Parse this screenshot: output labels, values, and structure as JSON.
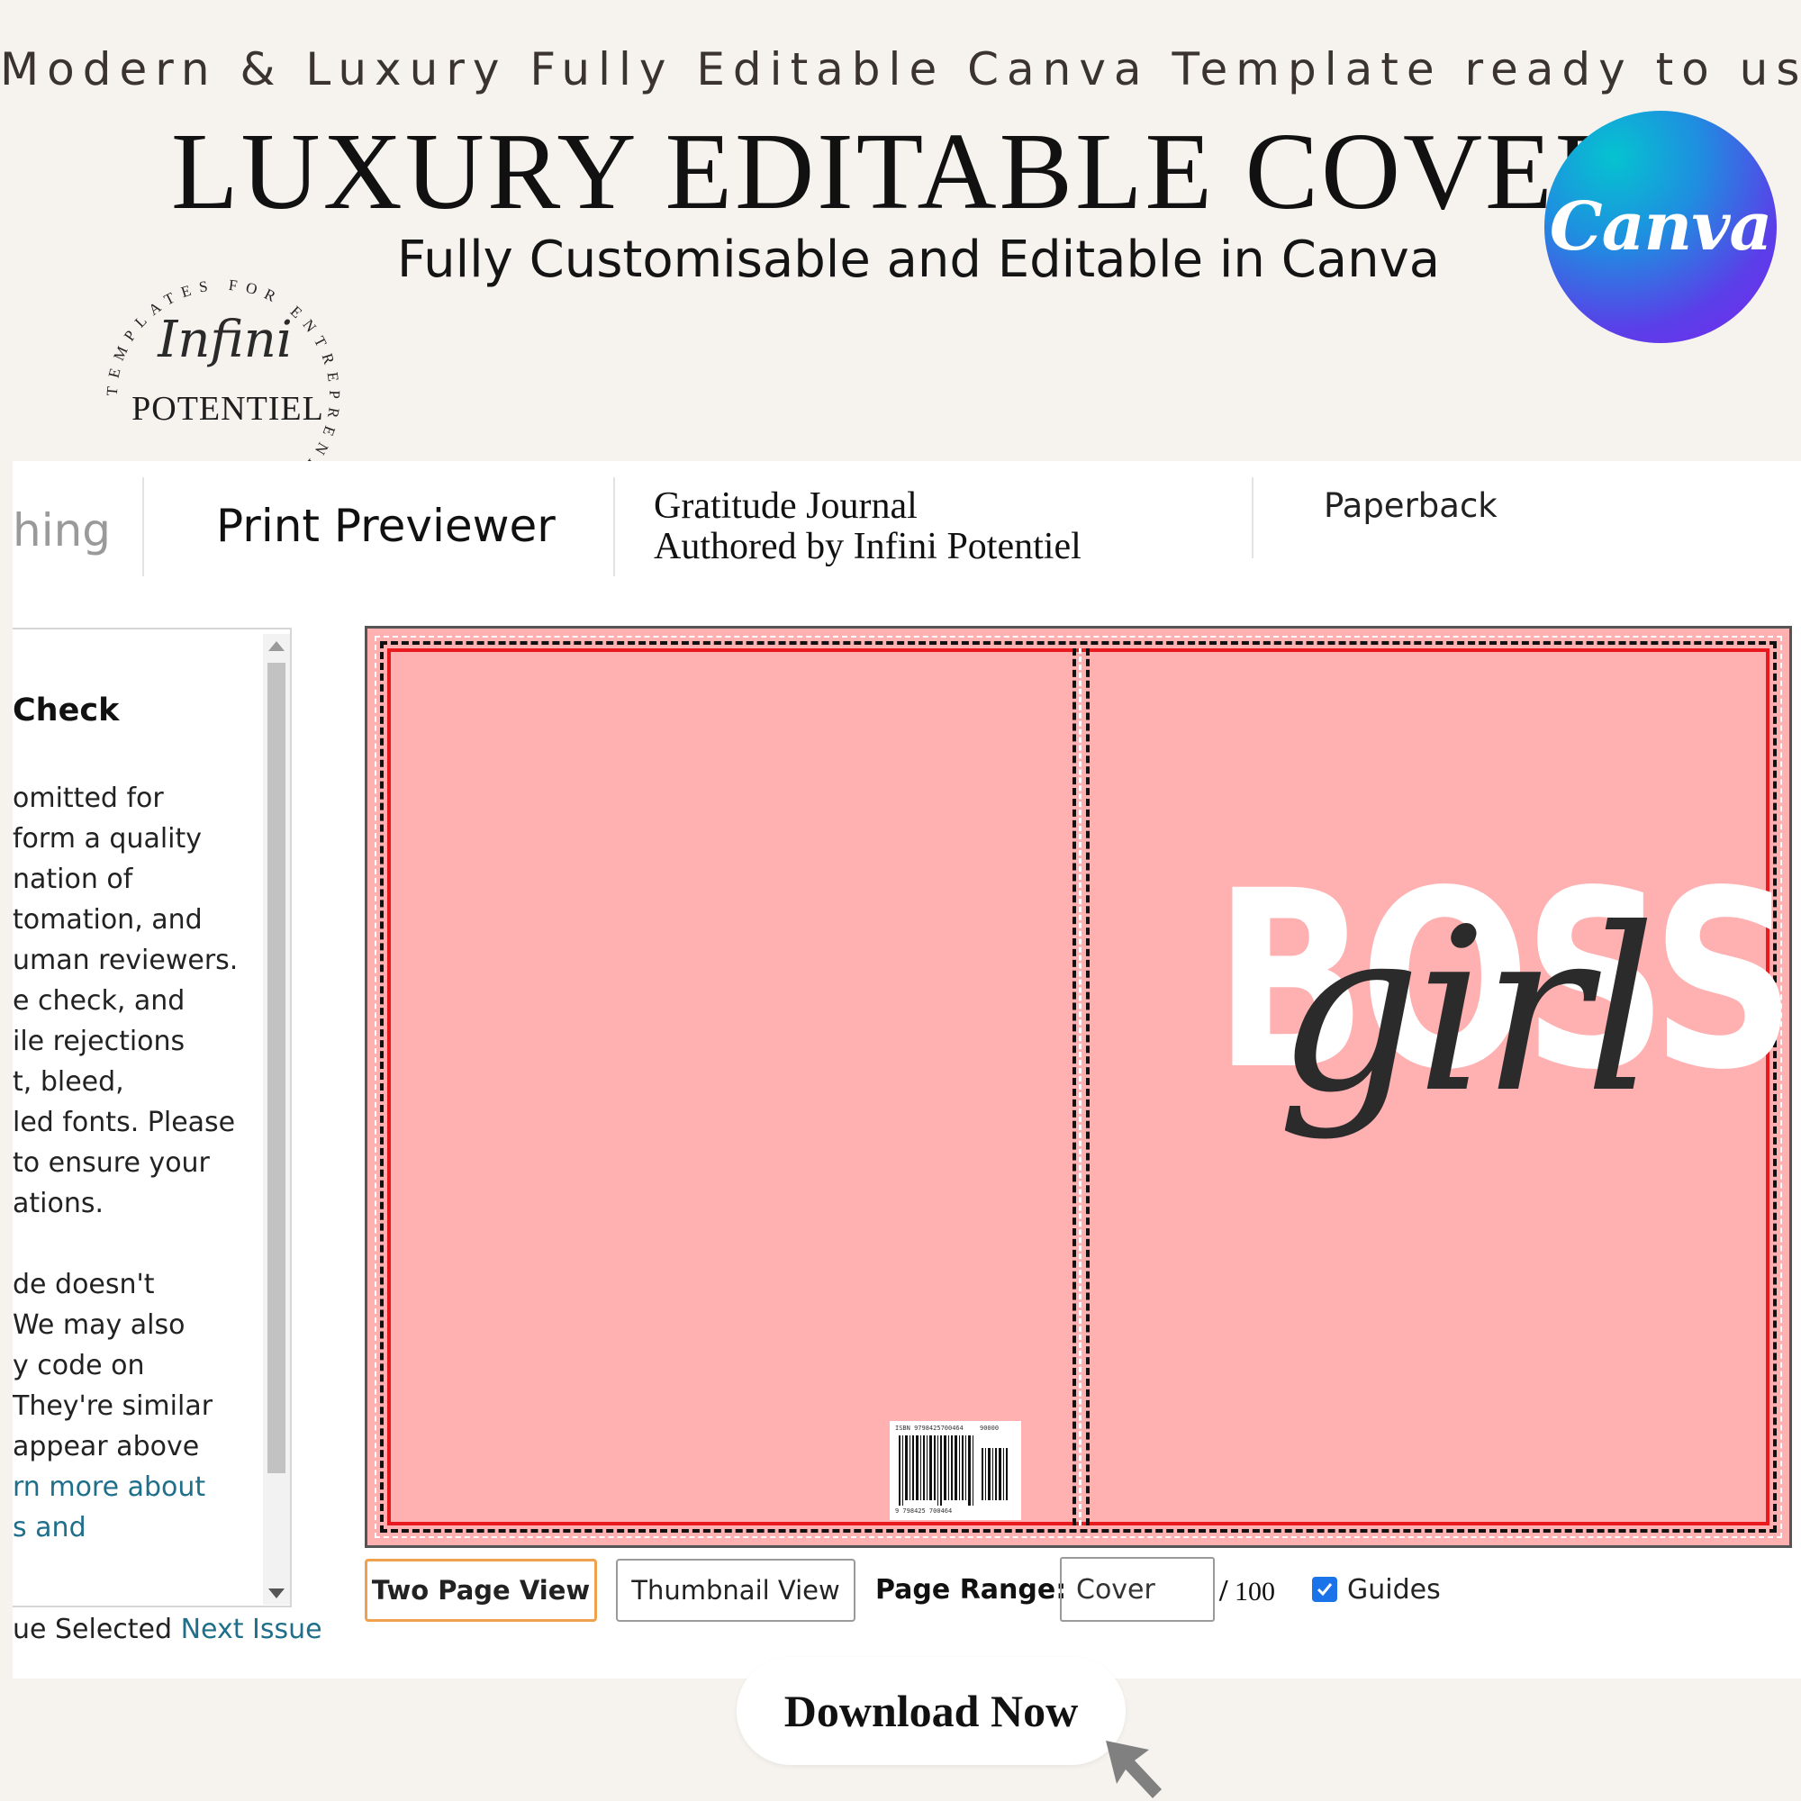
{
  "header": {
    "tagline": "Modern & Luxury Fully Editable Canva Template ready to use",
    "title": "LUXURY EDITABLE COVER",
    "subtitle": "Fully Customisable and Editable in Canva",
    "canva_badge": "Canva"
  },
  "seal": {
    "ring_text": "TEMPLATES FOR ENTREPRENEURS GENIUS",
    "script": "Infini",
    "name": "POTENTIEL"
  },
  "app": {
    "tab_partial": "hing",
    "tab_active": "Print Previewer",
    "book_title": "Gratitude Journal",
    "book_author": "Authored by Infini Potentiel",
    "format": "Paperback"
  },
  "sidebar": {
    "heading": "Check",
    "lines": [
      "omitted for",
      "form a quality",
      "nation of",
      "tomation, and",
      "uman reviewers.",
      "e check, and",
      "ile rejections",
      "t, bleed,",
      "led fonts. Please",
      "to ensure your",
      "ations.",
      "de doesn't",
      "We may also",
      "y code on",
      "They're similar",
      "appear above"
    ],
    "link_lines": [
      "rn more about",
      "s and"
    ],
    "footer_selected": "ue Selected",
    "footer_next": "Next Issue"
  },
  "cover": {
    "title_word": "BOSS",
    "script_word": "girl",
    "barcode_text": "ISBN 9798425700464",
    "barcode_number": "9 798425 700464",
    "barcode_price": "90000",
    "background_color": "#ffb0b1"
  },
  "toolbar": {
    "two_page": "Two Page View",
    "thumbnail": "Thumbnail View",
    "range_label": "Page Range:",
    "range_value": "Cover",
    "range_total": "100",
    "guides_label": "Guides",
    "guides_checked": true
  },
  "cta": {
    "download": "Download Now"
  },
  "colors": {
    "background": "#f6f3ef",
    "accent_orange": "#f0a14d",
    "link": "#1f6f8b",
    "guide_red": "#e8191f",
    "checkbox": "#1a73e8"
  }
}
